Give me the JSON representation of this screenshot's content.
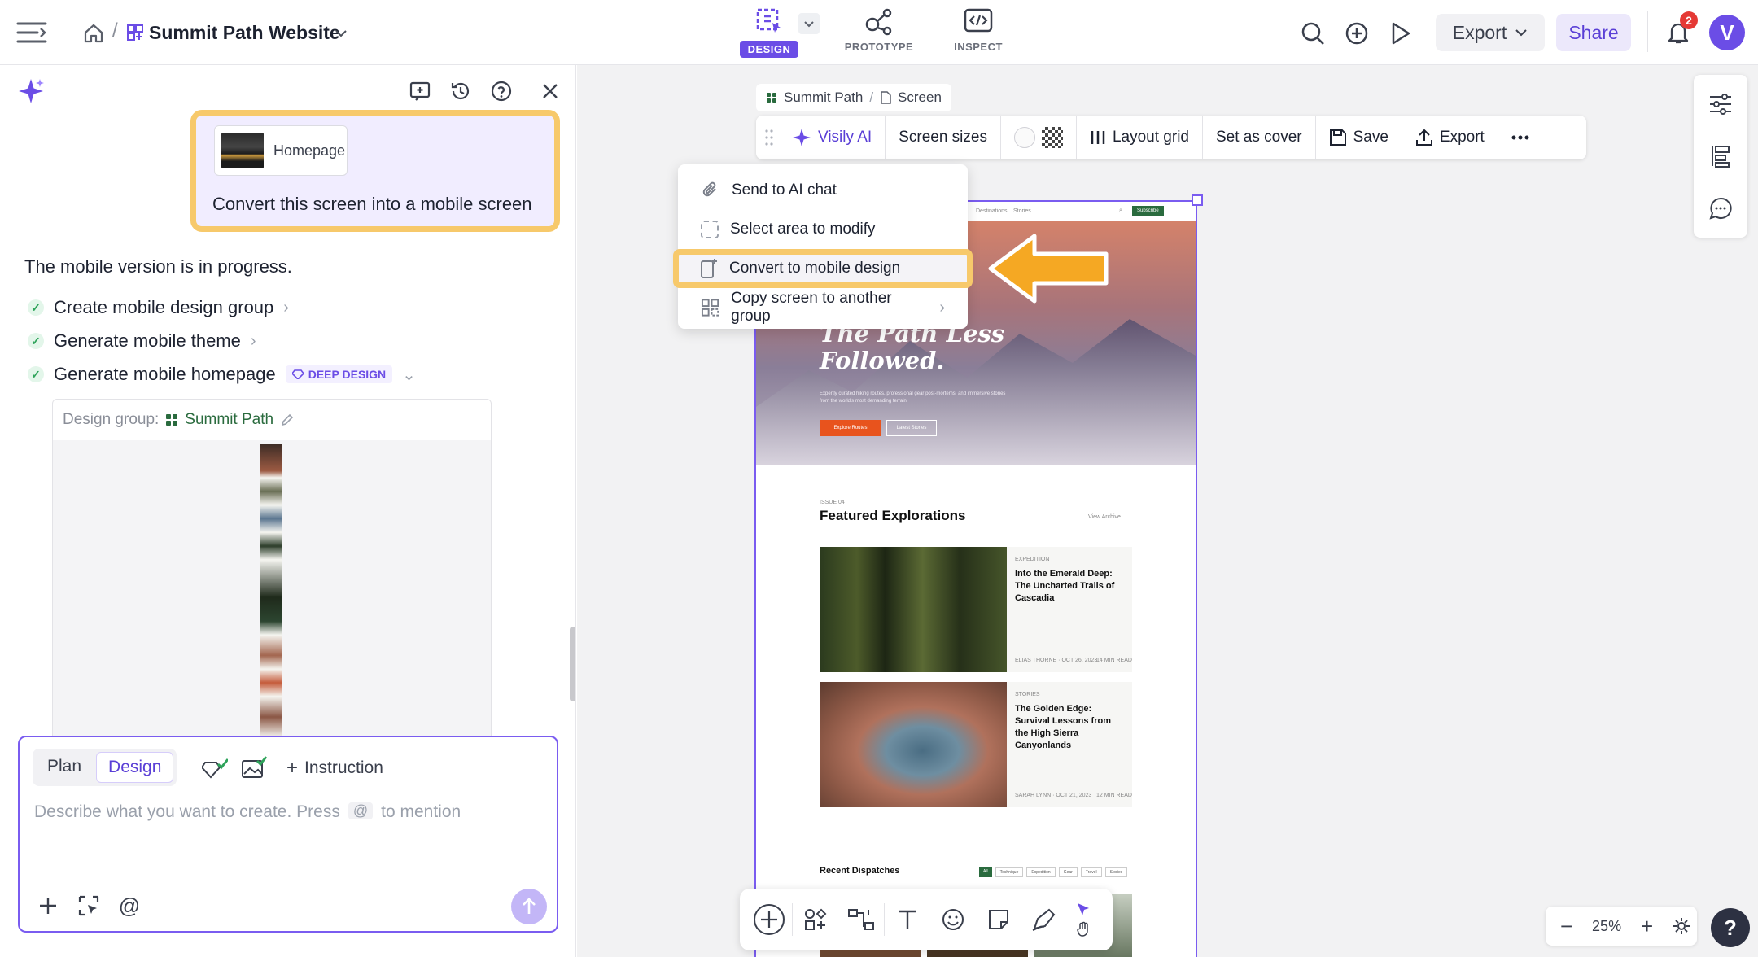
{
  "header": {
    "project_title": "Summit Path Website",
    "modes": [
      {
        "label": "DESIGN",
        "active": true
      },
      {
        "label": "PROTOTYPE",
        "active": false
      },
      {
        "label": "INSPECT",
        "active": false
      }
    ],
    "export_label": "Export",
    "share_label": "Share",
    "notification_count": "2",
    "avatar_letter": "V"
  },
  "chat": {
    "attachment_label": "Homepage",
    "user_message": "Convert this screen into a mobile screen",
    "assistant_message": "The mobile version is in progress.",
    "steps": [
      {
        "label": "Create mobile design group"
      },
      {
        "label": "Generate mobile theme"
      },
      {
        "label": "Generate mobile homepage",
        "badge": "DEEP DESIGN"
      }
    ],
    "design_group_label": "Design group:",
    "design_group_name": "Summit Path"
  },
  "composer": {
    "mode_plan": "Plan",
    "mode_design": "Design",
    "instruction_label": "Instruction",
    "placeholder_prefix": "Describe what you want to create. Press",
    "mention_key": "@",
    "placeholder_suffix": "to mention"
  },
  "canvas": {
    "breadcrumb_group": "Summit Path",
    "breadcrumb_screen": "Screen",
    "toolbar": {
      "ai_label": "Visily AI",
      "screen_sizes": "Screen sizes",
      "layout_grid": "Layout grid",
      "set_as_cover": "Set as cover",
      "save": "Save",
      "export": "Export"
    },
    "context_menu": [
      {
        "label": "Send to AI chat",
        "highlighted": false
      },
      {
        "label": "Select area to modify",
        "highlighted": false
      },
      {
        "label": "Convert to mobile design",
        "highlighted": true
      },
      {
        "label": "Copy screen to another group",
        "highlighted": false
      }
    ],
    "zoom": "25%"
  },
  "frame": {
    "nav_links": [
      "Destinations",
      "Stories"
    ],
    "subscribe": "Subscribe",
    "hero_title_1": "The Path Less",
    "hero_title_2": "Followed.",
    "hero_sub": "Expertly curated hiking routes, professional gear post-mortems, and immersive stories from the world's most demanding terrain.",
    "cta_primary": "Explore Routes",
    "cta_secondary": "Latest Stories",
    "issue_label": "ISSUE 04",
    "featured_title": "Featured Explorations",
    "view_archive": "View Archive",
    "cards": [
      {
        "tag": "EXPEDITION",
        "title": "Into the Emerald Deep: The Uncharted Trails of Cascadia",
        "meta": "ELIAS THORNE · OCT 26, 2023",
        "read": "14 MIN READ"
      },
      {
        "tag": "STORIES",
        "title": "The Golden Edge: Survival Lessons from the High Sierra Canyonlands",
        "meta": "SARAH LYNN · OCT 21, 2023",
        "read": "12 MIN READ"
      }
    ],
    "recent_title": "Recent Dispatches",
    "filters": [
      "All",
      "Technique",
      "Expedition",
      "Gear",
      "Travel",
      "Stories"
    ]
  },
  "colors": {
    "accent": "#6b4de6",
    "highlight": "#f7c96b",
    "arrow": "#f5a823",
    "cta": "#e8531d",
    "brand_green": "#2a6b3e"
  }
}
